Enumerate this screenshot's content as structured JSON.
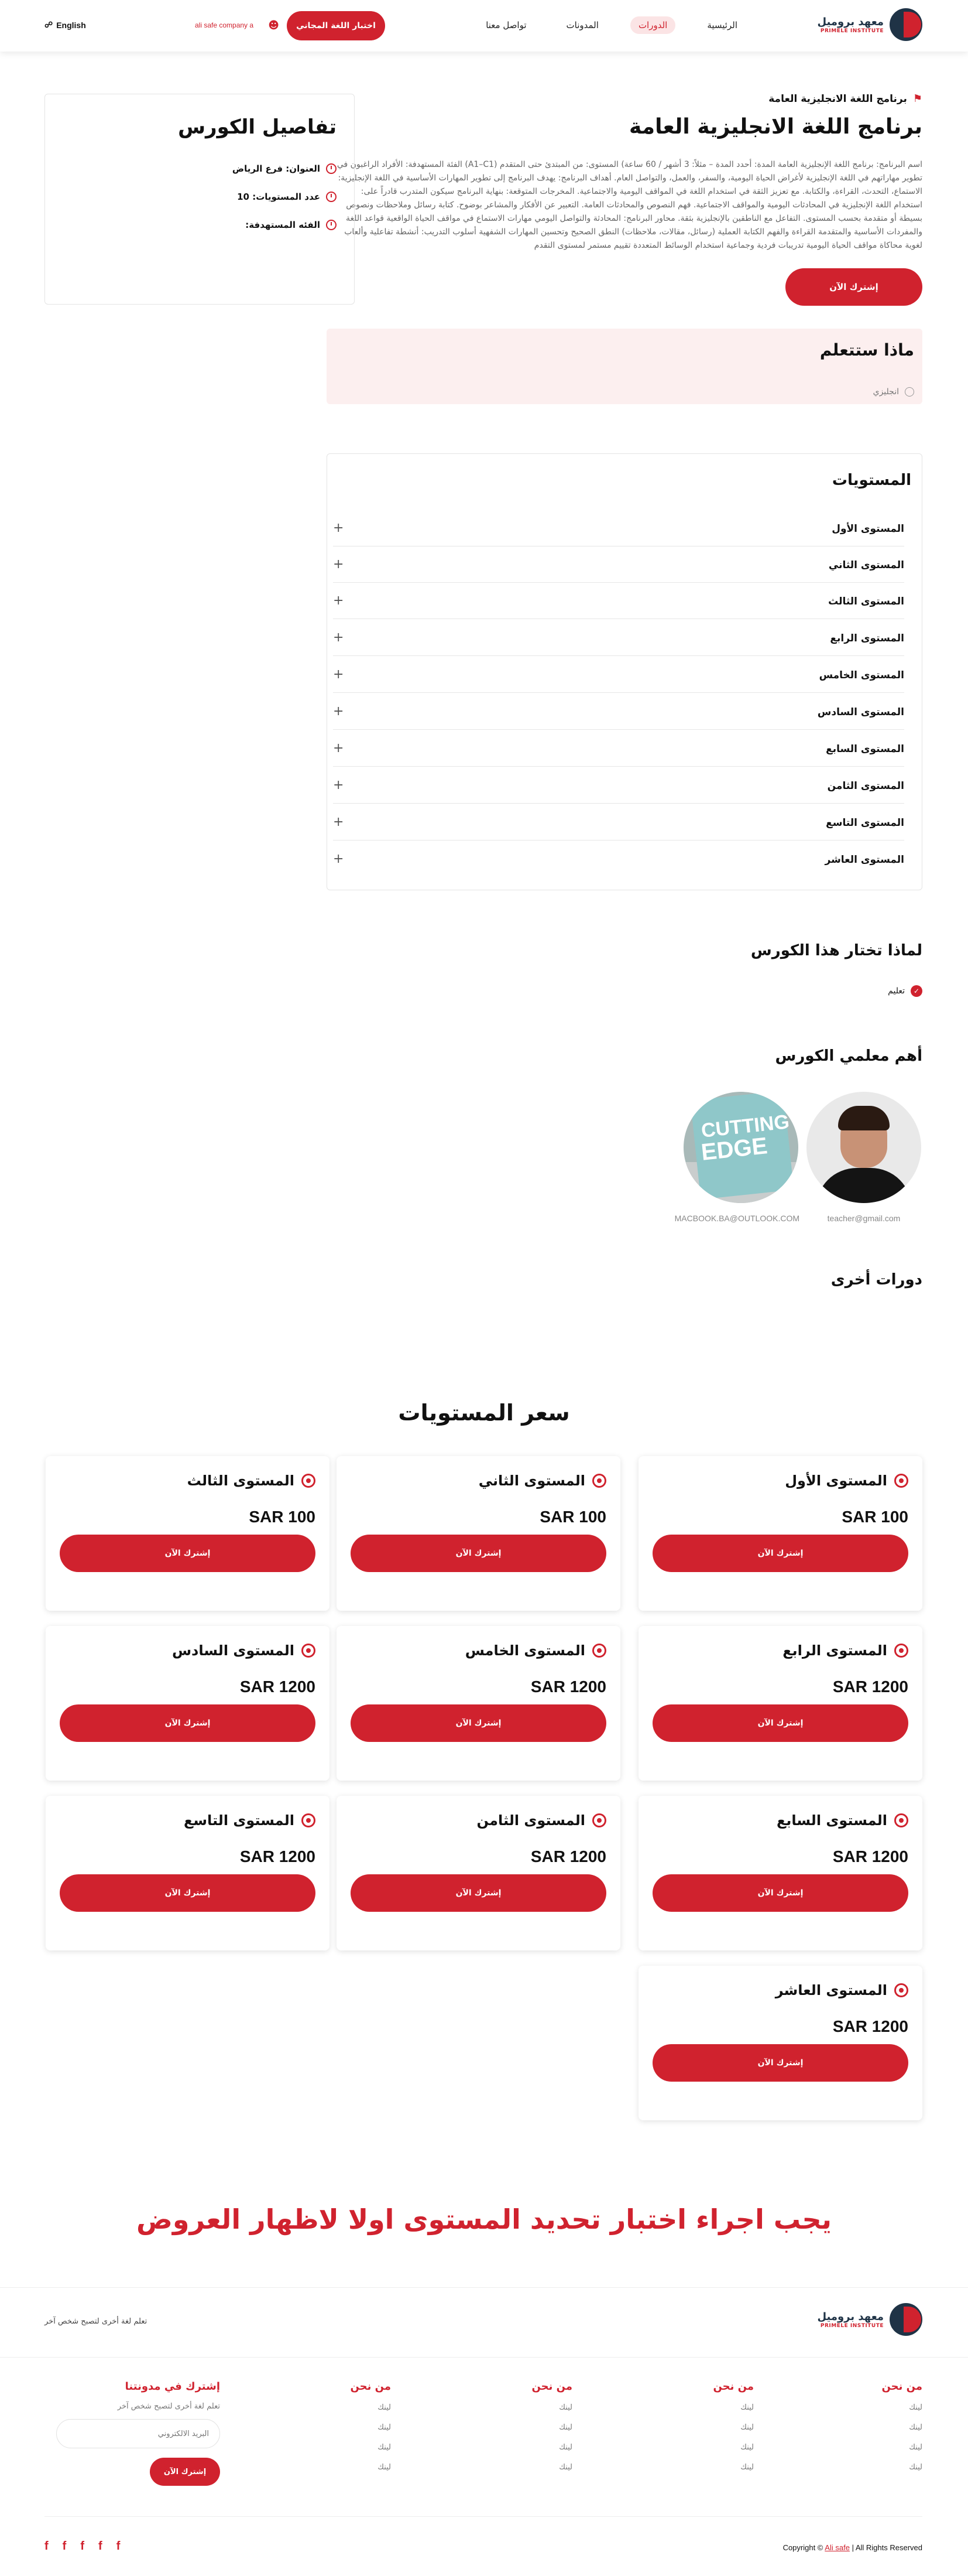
{
  "header": {
    "logo_name": "معهد بروميل",
    "logo_sub": "PRIMELE INSTITUTE",
    "nav": [
      "الرئيسية",
      "الدورات",
      "المدونات",
      "تواصل معنا"
    ],
    "test_button": "اختبار اللغة المجاني",
    "company": "ali safe company a",
    "lang": "English"
  },
  "course": {
    "kicker": "برنامج اللغة الانجليزية العامة",
    "title": "برنامج اللغة الانجليزية العامة",
    "description": "اسم البرنامج: برنامج اللغة الإنجليزية العامة المدة: أحدد المدة – مثلاً: 3 أشهر / 60 ساعة) المستوى: من المبتدئ حتى المتقدم (A1–C1) الفئة المستهدفة: الأفراد الراغبون في تطوير مهاراتهم في اللغة الإنجليزية لأغراض الحياة اليومية، والسفر، والعمل، والتواصل العام. أهداف البرنامج: يهدف البرنامج إلى تطوير المهارات الأساسية في اللغة الإنجليزية: الاستماع، التحدث، القراءة، والكتابة. مع تعزيز الثقة في استخدام اللغة في المواقف اليومية والاجتماعية. المخرجات المتوقعة: بنهاية البرنامج سيكون المتدرب قادراً على: استخدام اللغة الإنجليزية في المحادثات اليومية والمواقف الاجتماعية. فهم النصوص والمحادثات العامة. التعبير عن الأفكار والمشاعر بوضوح. كتابة رسائل وملاحظات ونصوص بسيطة أو متقدمة بحسب المستوى. التفاعل مع الناطقين بالإنجليزية بثقة. محاور البرنامج: المحادثة والتواصل اليومي مهارات الاستماع في مواقف الحياة الواقعية قواعد اللغة والمفردات الأساسية والمتقدمة القراءة والفهم الكتابة العملية (رسائل، مقالات، ملاحظات) النطق الصحيح وتحسين المهارات الشفهية أسلوب التدريب: أنشطة تفاعلية وألعاب لغوية محاكاة مواقف الحياة اليومية تدريبات فردية وجماعية استخدام الوسائط المتعددة تقييم مستمر لمستوى التقدم",
    "subscribe": "إشترك الآن"
  },
  "details": {
    "title": "تفاصيل الكورس",
    "address": "العنوان: فرع الرياض",
    "levels_count": "عدد المستويات: 10",
    "audience": "الفئه المستهدفة:"
  },
  "learn": {
    "title": "ماذا ستتعلم",
    "item": "انجليزي"
  },
  "levels": {
    "title": "المستويات",
    "items": [
      "المستوى الأول",
      "المستوى الثاني",
      "المستوى الثالث",
      "المستوى الرابع",
      "المستوى الخامس",
      "المستوى السادس",
      "المستوى السابع",
      "المستوى الثامن",
      "المستوى التاسع",
      "المستوى العاشر"
    ]
  },
  "why": {
    "title": "لماذا تختار هذا الكورس",
    "item": "تعليم"
  },
  "teachers": {
    "title": "أهم معلمي الكورس",
    "items": [
      {
        "email": "teacher@gmail.com",
        "avatar": "man-photo"
      },
      {
        "email": "MACBOOK.BA@OUTLOOK.COM",
        "avatar": "cutting-edge-book-cover",
        "book_line1": "CUTTING",
        "book_line2": "EDGE"
      }
    ]
  },
  "other": {
    "title": "دورات أخرى"
  },
  "prices": {
    "title": "سعر المستويات",
    "button": "إشترك الآن",
    "cards": [
      {
        "name": "المستوى الأول",
        "price": "SAR 100"
      },
      {
        "name": "المستوى الثاني",
        "price": "SAR 100"
      },
      {
        "name": "المستوى الثالث",
        "price": "SAR 100"
      },
      {
        "name": "المستوى الرابع",
        "price": "SAR 1200"
      },
      {
        "name": "المستوى الخامس",
        "price": "SAR 1200"
      },
      {
        "name": "المستوى السادس",
        "price": "SAR 1200"
      },
      {
        "name": "المستوى السابع",
        "price": "SAR 1200"
      },
      {
        "name": "المستوى الثامن",
        "price": "SAR 1200"
      },
      {
        "name": "المستوى التاسع",
        "price": "SAR 1200"
      },
      {
        "name": "المستوى العاشر",
        "price": "SAR 1200"
      }
    ]
  },
  "banner": "يجب اجراء اختبار تحديد المستوى اولا لاظهار العروض",
  "footer": {
    "tagline": "تعلم لغة أخرى لتصبح شخص آخر",
    "columns": [
      {
        "heading": "من نحن",
        "links": [
          "لينك",
          "لينك",
          "لينك",
          "لينك"
        ]
      },
      {
        "heading": "من نحن",
        "links": [
          "لينك",
          "لينك",
          "لينك",
          "لينك"
        ]
      },
      {
        "heading": "من نحن",
        "links": [
          "لينك",
          "لينك",
          "لينك",
          "لينك"
        ]
      },
      {
        "heading": "من نحن",
        "links": [
          "لينك",
          "لينك",
          "لينك",
          "لينك"
        ]
      }
    ],
    "newsletter_title": "إشترك في مدونتنا",
    "newsletter_sub": "تعلم لغة أخرى لتصبح شخص آخر",
    "email_placeholder": "البريد الالكتروني",
    "newsletter_button": "إشترك الآن",
    "copyright_prefix": "Copyright ©",
    "copyright_link": "Ali safe",
    "copyright_suffix": "| All Rights Reserved",
    "socials": [
      "f",
      "f",
      "f",
      "f",
      "f"
    ]
  },
  "colors": {
    "accent": "#d0222e",
    "navy": "#1f3346",
    "soft_pink": "#fcefef"
  }
}
